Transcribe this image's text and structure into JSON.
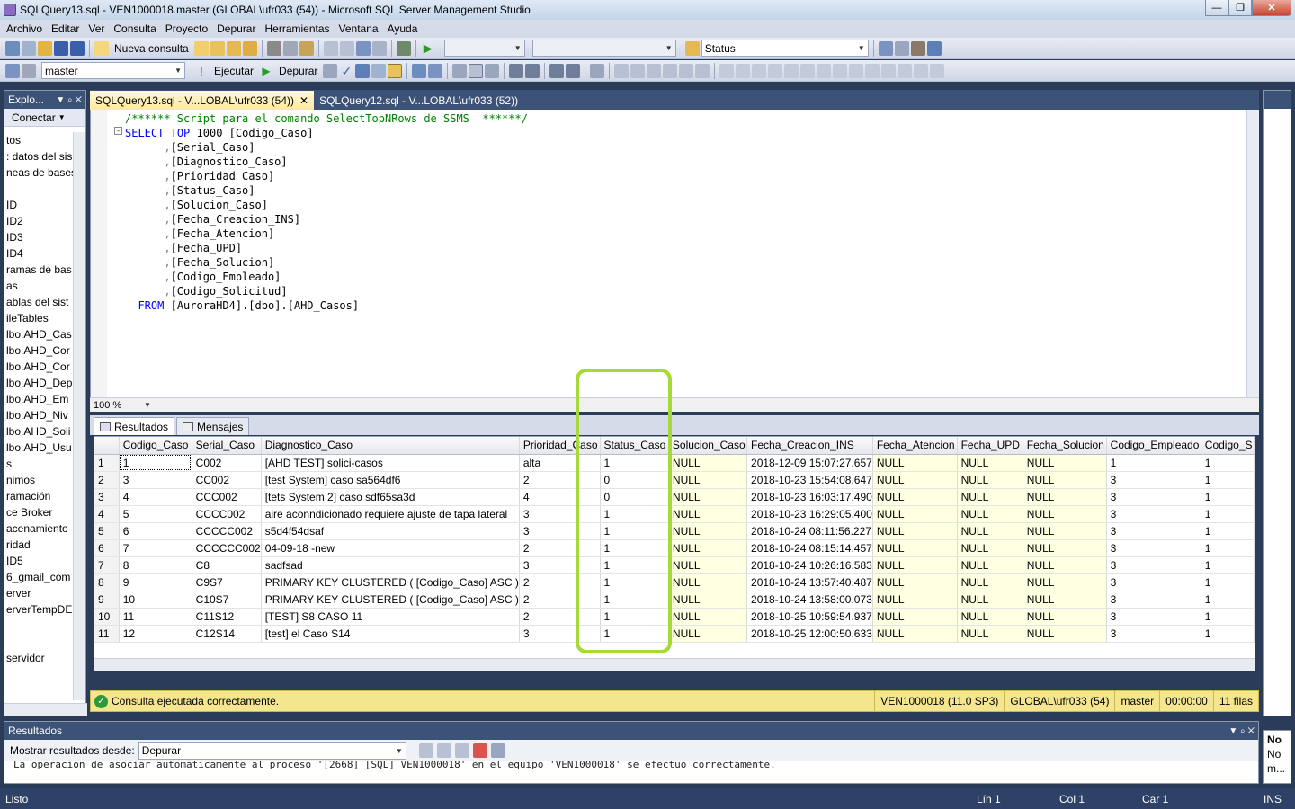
{
  "window": {
    "title": "SQLQuery13.sql - VEN1000018.master (GLOBAL\\ufr033 (54)) - Microsoft SQL Server Management Studio"
  },
  "menu": [
    "Archivo",
    "Editar",
    "Ver",
    "Consulta",
    "Proyecto",
    "Depurar",
    "Herramientas",
    "Ventana",
    "Ayuda"
  ],
  "toolbar1": {
    "nueva_consulta": "Nueva consulta",
    "status_combo": "Status"
  },
  "toolbar2": {
    "database": "master",
    "ejecutar": "Ejecutar",
    "depurar": "Depurar"
  },
  "explorer": {
    "title": "Explo...",
    "connect": "Conectar",
    "items": [
      "tos",
      ": datos del sis",
      "neas de bases",
      "",
      "ID",
      "ID2",
      "ID3",
      "ID4",
      "ramas de bas",
      "as",
      "ablas del sist",
      "ileTables",
      "lbo.AHD_Cas",
      "lbo.AHD_Cor",
      "lbo.AHD_Cor",
      "lbo.AHD_Dep",
      "lbo.AHD_Em",
      "lbo.AHD_Niv",
      "lbo.AHD_Soli",
      "lbo.AHD_Usu",
      "s",
      "nimos",
      "ramación",
      "ce Broker",
      "acenamiento",
      "ridad",
      "ID5",
      "6_gmail_com",
      "erver",
      "erverTempDE",
      "",
      "",
      "servidor"
    ]
  },
  "tabs": [
    {
      "label": "SQLQuery13.sql - V...LOBAL\\ufr033 (54))",
      "active": true
    },
    {
      "label": "SQLQuery12.sql - V...LOBAL\\ufr033 (52))",
      "active": false
    }
  ],
  "editor": {
    "comment": "/****** Script para el comando SelectTopNRows de SSMS  ******/",
    "select_kw": "SELECT",
    "top_kw": "TOP",
    "top_n": "1000",
    "first_col": "[Codigo_Caso]",
    "columns": [
      "[Serial_Caso]",
      "[Diagnostico_Caso]",
      "[Prioridad_Caso]",
      "[Status_Caso]",
      "[Solucion_Caso]",
      "[Fecha_Creacion_INS]",
      "[Fecha_Atencion]",
      "[Fecha_UPD]",
      "[Fecha_Solucion]",
      "[Codigo_Empleado]",
      "[Codigo_Solicitud]"
    ],
    "from_kw": "FROM",
    "from_table": "[AuroraHD4].[dbo].[AHD_Casos]",
    "zoom": "100 %"
  },
  "results": {
    "tab_results": "Resultados",
    "tab_messages": "Mensajes",
    "headers": [
      "Codigo_Caso",
      "Serial_Caso",
      "Diagnostico_Caso",
      "Prioridad_Caso",
      "Status_Caso",
      "Solucion_Caso",
      "Fecha_Creacion_INS",
      "Fecha_Atencion",
      "Fecha_UPD",
      "Fecha_Solucion",
      "Codigo_Empleado",
      "Codigo_S"
    ],
    "rows": [
      [
        "1",
        "1",
        "C002",
        "[AHD TEST] solici-casos",
        "alta",
        "1",
        "NULL",
        "2018-12-09 15:07:27.657",
        "NULL",
        "NULL",
        "NULL",
        "1",
        "1"
      ],
      [
        "2",
        "3",
        "CC002",
        "[test System] caso sa564df6",
        "2",
        "0",
        "NULL",
        "2018-10-23 15:54:08.647",
        "NULL",
        "NULL",
        "NULL",
        "3",
        "1"
      ],
      [
        "3",
        "4",
        "CCC002",
        "[tets System 2] caso sdf65sa3d",
        "4",
        "0",
        "NULL",
        "2018-10-23 16:03:17.490",
        "NULL",
        "NULL",
        "NULL",
        "3",
        "1"
      ],
      [
        "4",
        "5",
        "CCCC002",
        "aire aconndicionado requiere ajuste de tapa lateral",
        "3",
        "1",
        "NULL",
        "2018-10-23 16:29:05.400",
        "NULL",
        "NULL",
        "NULL",
        "3",
        "1"
      ],
      [
        "5",
        "6",
        "CCCCC002",
        "s5d4f54dsaf",
        "3",
        "1",
        "NULL",
        "2018-10-24 08:11:56.227",
        "NULL",
        "NULL",
        "NULL",
        "3",
        "1"
      ],
      [
        "6",
        "7",
        "CCCCCC002",
        "04-09-18 -new",
        "2",
        "1",
        "NULL",
        "2018-10-24 08:15:14.457",
        "NULL",
        "NULL",
        "NULL",
        "3",
        "1"
      ],
      [
        "7",
        "8",
        "C8",
        "sadfsad",
        "3",
        "1",
        "NULL",
        "2018-10-24 10:26:16.583",
        "NULL",
        "NULL",
        "NULL",
        "3",
        "1"
      ],
      [
        "8",
        "9",
        "C9S7",
        "PRIMARY KEY CLUSTERED  (  [Codigo_Caso] ASC  )",
        "2",
        "1",
        "NULL",
        "2018-10-24 13:57:40.487",
        "NULL",
        "NULL",
        "NULL",
        "3",
        "1"
      ],
      [
        "9",
        "10",
        "C10S7",
        "PRIMARY KEY CLUSTERED  (  [Codigo_Caso] ASC  )",
        "2",
        "1",
        "NULL",
        "2018-10-24 13:58:00.073",
        "NULL",
        "NULL",
        "NULL",
        "3",
        "1"
      ],
      [
        "10",
        "11",
        "C11S12",
        "[TEST] S8 CASO 11",
        "2",
        "1",
        "NULL",
        "2018-10-25 10:59:54.937",
        "NULL",
        "NULL",
        "NULL",
        "3",
        "1"
      ],
      [
        "11",
        "12",
        "C12S14",
        "[test] el Caso S14",
        "3",
        "1",
        "NULL",
        "2018-10-25 12:00:50.633",
        "NULL",
        "NULL",
        "NULL",
        "3",
        "1"
      ]
    ]
  },
  "exec_status": {
    "message": "Consulta ejecutada correctamente.",
    "server": "VEN1000018 (11.0 SP3)",
    "login": "GLOBAL\\ufr033 (54)",
    "database": "master",
    "elapsed": "00:00:00",
    "rows": "11 filas"
  },
  "output_panel": {
    "title": "Resultados",
    "show_from_label": "Mostrar resultados desde:",
    "show_from_value": "Depurar",
    "text": "La operación de asociar automáticamente al proceso '[2668] [SQL] VEN1000018' en el equipo 'VEN1000018' se efectuó correctamente."
  },
  "right_strip": {
    "lines": [
      "No",
      "No",
      "m..."
    ]
  },
  "statusbar": {
    "ready": "Listo",
    "line": "Lín 1",
    "col": "Col 1",
    "car": "Car 1",
    "mode": "INS"
  },
  "colors": {
    "accent": "#3d5277",
    "highlight": "#a6d93a",
    "status_strip": "#f3e68f"
  }
}
